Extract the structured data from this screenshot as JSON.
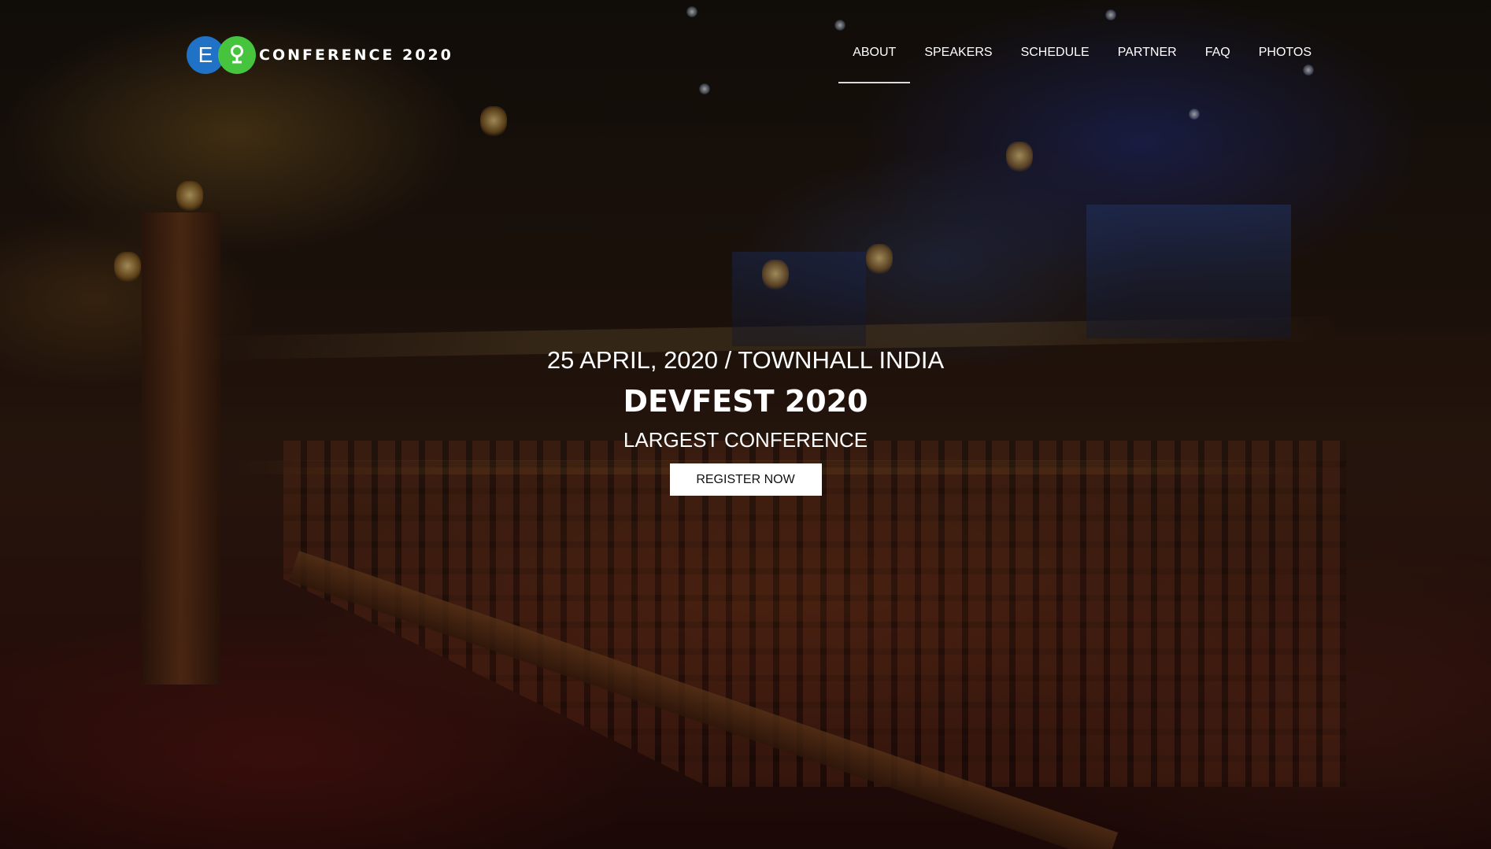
{
  "brand": {
    "logo_letter_1": "E",
    "logo_letter_2": "♀",
    "name": "CONFERENCE 2020",
    "colors": {
      "logo_blue": "#1f72c6",
      "logo_green": "#46c43e"
    }
  },
  "nav": {
    "active": "ABOUT",
    "items": [
      "ABOUT",
      "SPEAKERS",
      "SCHEDULE",
      "PARTNER",
      "FAQ",
      "PHOTOS"
    ]
  },
  "hero": {
    "date_location": "25 APRIL, 2020 / TOWNHALL INDIA",
    "title": "DEVFEST 2020",
    "tagline": "LARGEST CONFERENCE",
    "register_label": "REGISTER NOW",
    "background": "theatre-auditorium-photo"
  }
}
